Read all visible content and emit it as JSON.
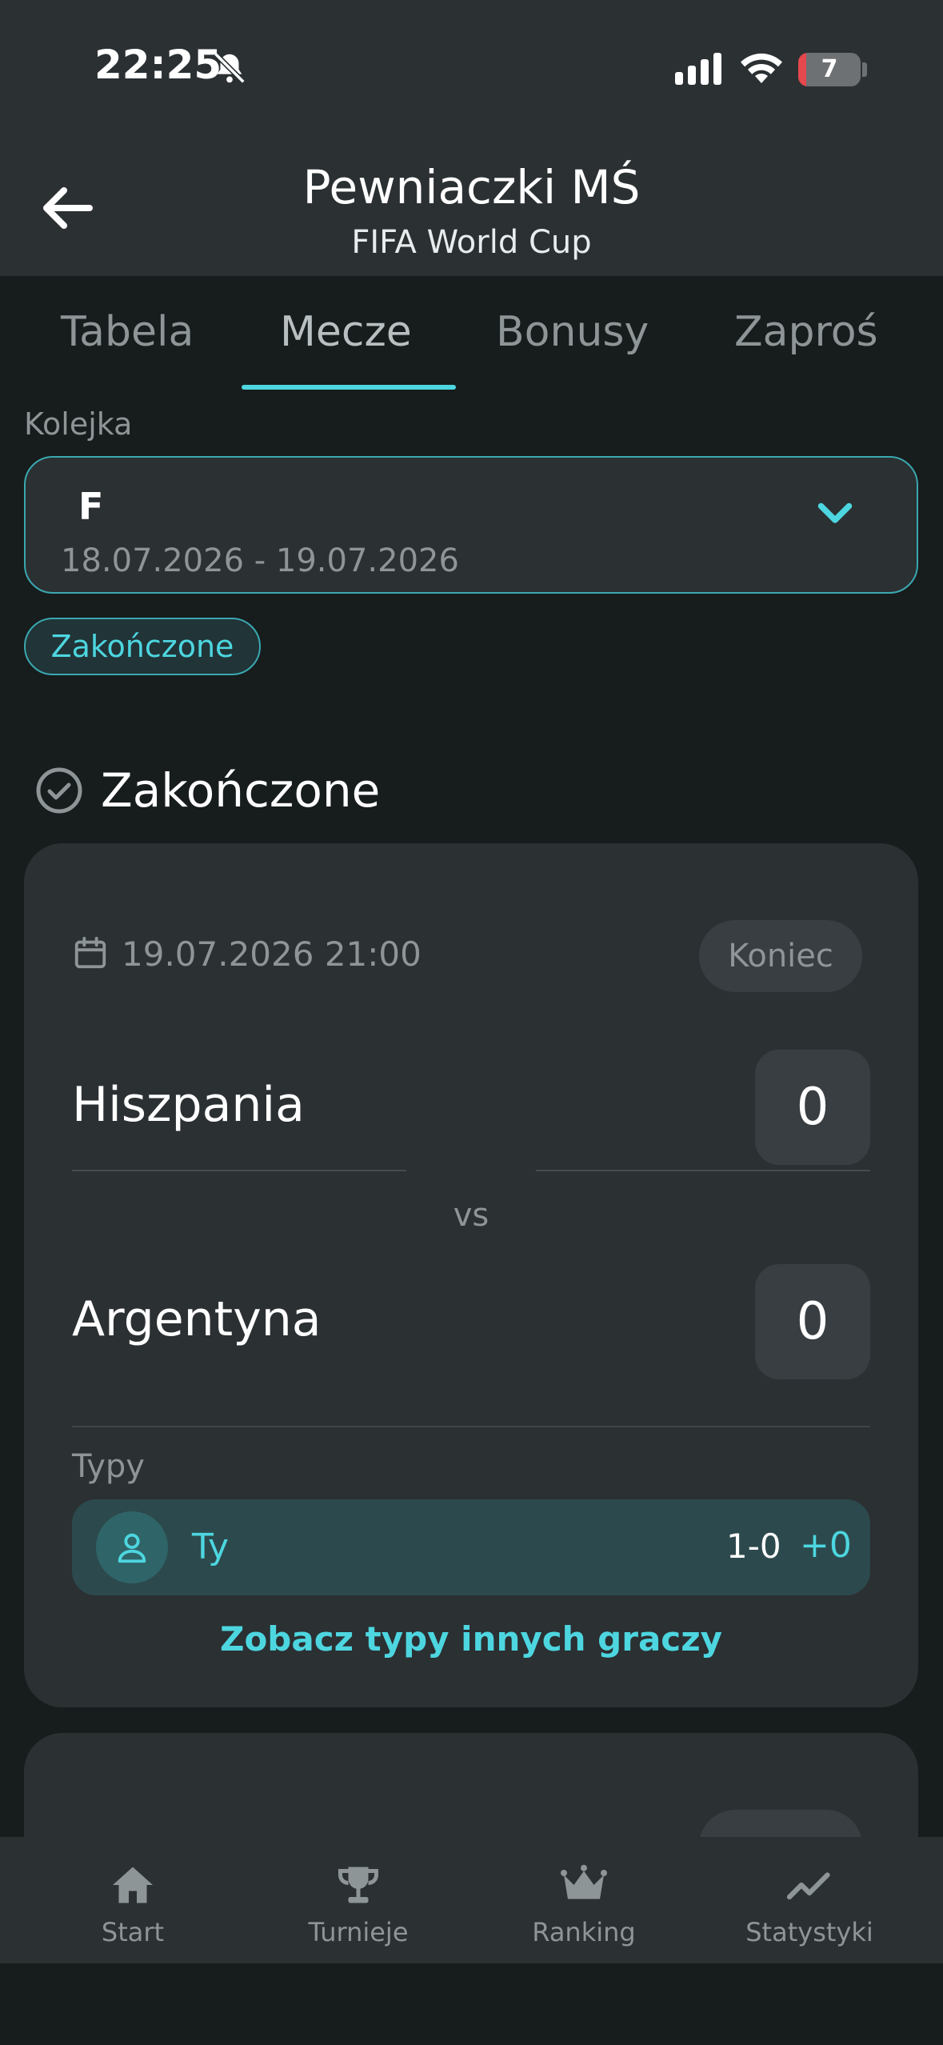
{
  "status_bar": {
    "time": "22:25",
    "battery": "7"
  },
  "header": {
    "title": "Pewniaczki MŚ",
    "subtitle": "FIFA World Cup"
  },
  "tabs": [
    {
      "label": "Tabela",
      "active": false
    },
    {
      "label": "Mecze",
      "active": true
    },
    {
      "label": "Bonusy",
      "active": false
    },
    {
      "label": "Zaproś",
      "active": false
    }
  ],
  "round": {
    "label": "Kolejka",
    "value": "F",
    "dates": "18.07.2026 - 19.07.2026"
  },
  "filter_chip": "Zakończone",
  "section": {
    "title": "Zakończone"
  },
  "match": {
    "datetime": "19.07.2026 21:00",
    "status": "Koniec",
    "home_team": "Hiszpania",
    "home_score": "0",
    "vs": "vs",
    "away_team": "Argentyna",
    "away_score": "0",
    "tips_label": "Typy",
    "tip": {
      "name": "Ty",
      "score": "1-0",
      "points": "+0"
    },
    "others_link": "Zobacz typy innych graczy"
  },
  "nav": [
    {
      "label": "Start",
      "icon": "home-icon"
    },
    {
      "label": "Turnieje",
      "icon": "trophy-icon"
    },
    {
      "label": "Ranking",
      "icon": "crown-icon"
    },
    {
      "label": "Statystyki",
      "icon": "chart-line-icon"
    }
  ],
  "colors": {
    "accent": "#4dd6e0",
    "background": "#171c1d",
    "surface": "#2b3033"
  }
}
